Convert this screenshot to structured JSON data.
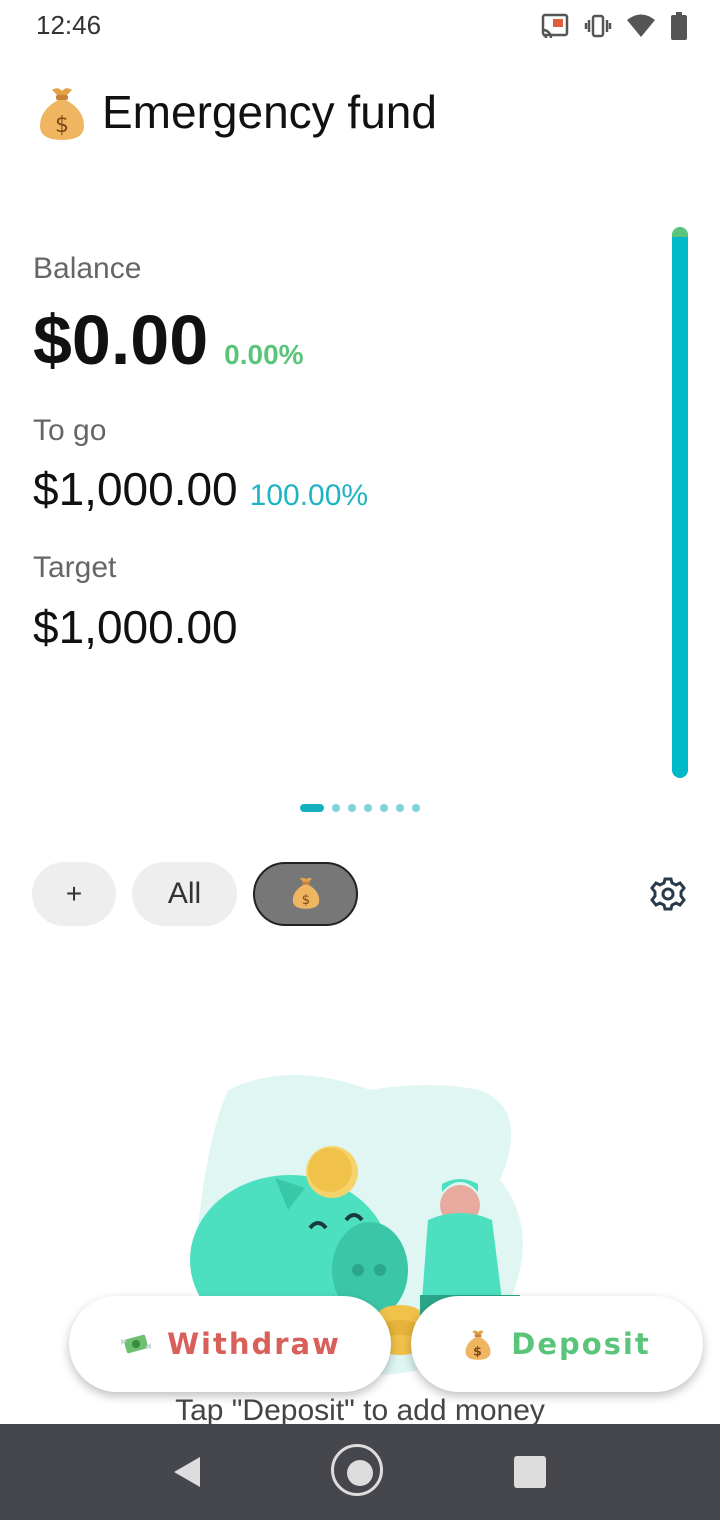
{
  "status": {
    "time": "12:46",
    "icons": [
      "cast-icon",
      "vibrate-icon",
      "wifi-icon",
      "battery-icon"
    ]
  },
  "header": {
    "icon": "money-bag-icon",
    "title": "Emergency fund"
  },
  "stats": {
    "balance_label": "Balance",
    "balance_value": "$0.00",
    "balance_pct": "0.00%",
    "togo_label": "To go",
    "togo_value": "$1,000.00",
    "togo_pct": "100.00%",
    "target_label": "Target",
    "target_value": "$1,000.00"
  },
  "progress": {
    "fraction": 0.0
  },
  "pager": {
    "count": 7,
    "active_index": 0
  },
  "chips": {
    "add_label": "+",
    "all_label": "All",
    "fund_icon": "money-bag-icon"
  },
  "actions": {
    "withdraw_label": "Withdraw",
    "deposit_label": "Deposit"
  },
  "empty_hint": "Tap \"Deposit\" to add money",
  "colors": {
    "accent_teal": "#00b8c8",
    "green": "#5ac47a",
    "red": "#d9605a"
  }
}
